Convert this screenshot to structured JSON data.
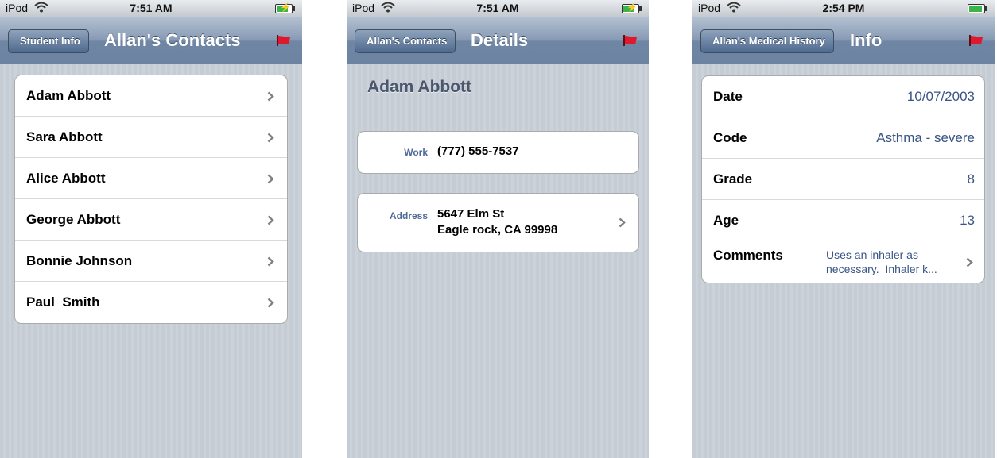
{
  "status": {
    "carrier": "iPod"
  },
  "screen1": {
    "time": "7:51 AM",
    "back_label": "Student Info",
    "title": "Allan's Contacts",
    "contacts": [
      {
        "name": "Adam Abbott"
      },
      {
        "name": "Sara Abbott"
      },
      {
        "name": "Alice Abbott"
      },
      {
        "name": "George Abbott"
      },
      {
        "name": "Bonnie Johnson"
      },
      {
        "name": "Paul  Smith"
      }
    ]
  },
  "screen2": {
    "time": "7:51 AM",
    "back_label": "Allan's Contacts",
    "title": "Details",
    "contact_name": "Adam Abbott",
    "work_label": "Work",
    "work_phone": "(777) 555-7537",
    "address_label": "Address",
    "address_line1": "5647 Elm St",
    "address_line2": "Eagle rock, CA 99998"
  },
  "screen3": {
    "time": "2:54 PM",
    "back_label": "Allan's Medical History",
    "title": "Info",
    "fields": [
      {
        "label": "Date",
        "value": "10/07/2003"
      },
      {
        "label": "Code",
        "value": "Asthma - severe"
      },
      {
        "label": "Grade",
        "value": "8"
      },
      {
        "label": "Age",
        "value": "13"
      }
    ],
    "comments_label": "Comments",
    "comments_line1": "Uses an inhaler as",
    "comments_line2": "necessary.  Inhaler k..."
  },
  "colors": {
    "navbar": "#6f87a4",
    "background_stripe": "#c5ccd4",
    "detail_label": "#4f6a98",
    "value_text": "#385487",
    "flag": "#e0182d",
    "battery_charging": "#3bb54a"
  },
  "icons": [
    "wifi-icon",
    "battery-icon",
    "flag-icon",
    "chevron-right-icon"
  ]
}
